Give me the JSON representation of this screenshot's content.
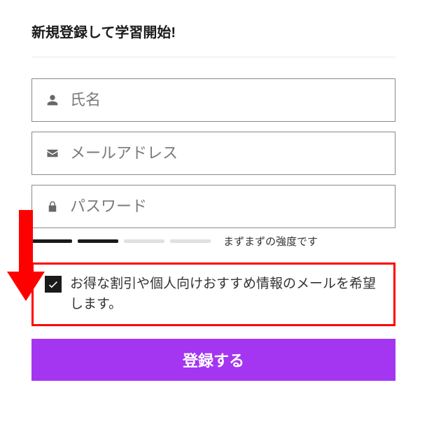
{
  "title": "新規登録して学習開始!",
  "fields": {
    "name": {
      "placeholder": "氏名",
      "value": ""
    },
    "email": {
      "placeholder": "メールアドレス",
      "value": ""
    },
    "password": {
      "placeholder": "パスワード",
      "value": ""
    }
  },
  "password_strength": {
    "filled_bars": 2,
    "total_bars": 4,
    "label": "まずまずの強度です"
  },
  "marketing_opt_in": {
    "checked": true,
    "label": "お得な割引や個人向けおすすめ情報のメールを希望します。"
  },
  "submit_label": "登録する",
  "annotation": {
    "arrow_color": "#ff0000",
    "highlight_color": "#ff0000"
  },
  "colors": {
    "primary": "#a435f0"
  }
}
